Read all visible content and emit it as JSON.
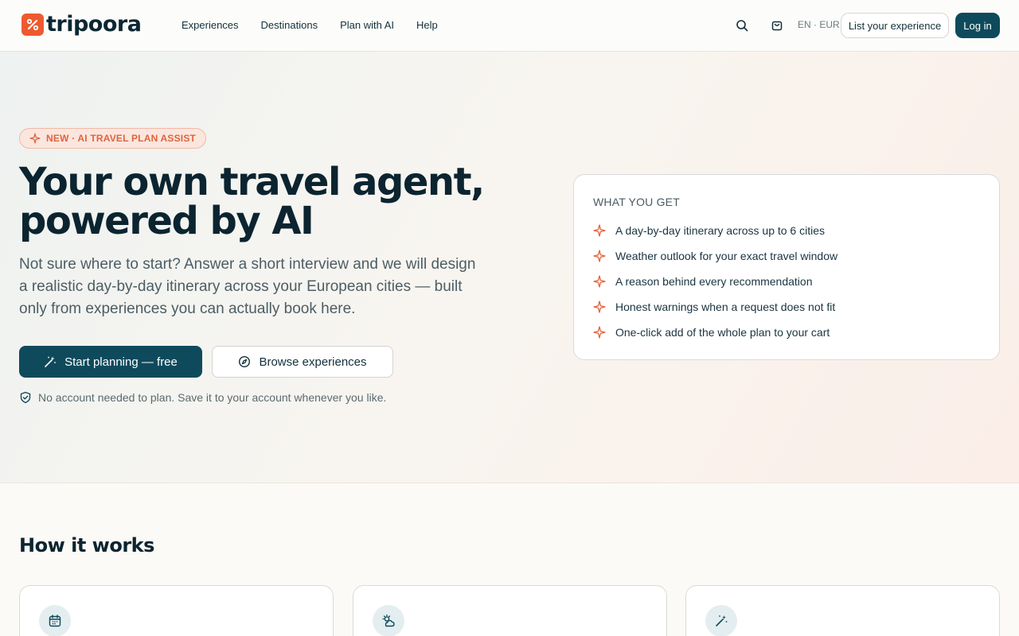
{
  "brand": {
    "name": "tripoora",
    "accent": "#ee5a2f",
    "primary": "#0f4a5c"
  },
  "nav": {
    "links": [
      "Experiences",
      "Destinations",
      "Plan with AI",
      "Help"
    ],
    "search_icon": "search-icon",
    "cart_icon": "shopping-bag-icon",
    "locale": "EN · EUR",
    "list_label": "List your experience",
    "login_label": "Log in"
  },
  "hero": {
    "badge": "NEW · AI TRAVEL PLAN ASSIST",
    "title_line1": "Your own travel agent,",
    "title_line2": "powered by AI",
    "lead": "Not sure where to start? Answer a short interview and we will design a realistic day-by-day itinerary across your European cities — built only from experiences you can actually book here.",
    "primary_cta": "Start planning — free",
    "secondary_cta": "Browse experiences",
    "note": "No account needed to plan. Save it to your account whenever you like."
  },
  "what_you_get": {
    "title": "WHAT YOU GET",
    "items": [
      "A day-by-day itinerary across up to 6 cities",
      "Weather outlook for your exact travel window",
      "A reason behind every recommendation",
      "Honest warnings when a request does not fit",
      "One-click add of the whole plan to your cart"
    ]
  },
  "how_it_works": {
    "title": "How it works",
    "step_icons": [
      "calendar-icon",
      "weather-icon",
      "magic-wand-icon"
    ]
  }
}
